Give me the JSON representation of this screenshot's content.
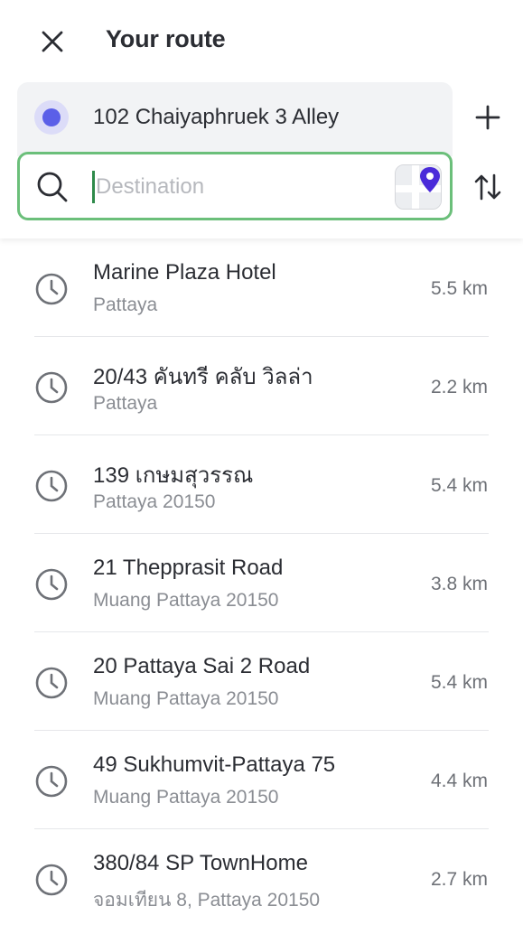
{
  "header": {
    "title": "Your route",
    "close_icon": "close-icon",
    "add_icon": "plus-icon",
    "swap_icon": "swap-vertical-icon"
  },
  "route": {
    "origin": "102 Chaiyaphruek 3 Alley",
    "destination_value": "",
    "destination_placeholder": "Destination",
    "map_picker_icon": "map-pin-icon"
  },
  "colors": {
    "accent": "#5b5fe8",
    "focus_border": "#6bbf7a"
  },
  "recents": [
    {
      "name": "Marine Plaza Hotel",
      "sub": "Pattaya",
      "dist": "5.5 km"
    },
    {
      "name": "20/43 คันทรี คลับ วิลล่า",
      "sub": "Pattaya",
      "dist": "2.2 km"
    },
    {
      "name": "139 เกษมสุวรรณ",
      "sub": "Pattaya 20150",
      "dist": "5.4 km"
    },
    {
      "name": "21 Thepprasit Road",
      "sub": "Muang Pattaya 20150",
      "dist": "3.8 km"
    },
    {
      "name": "20 Pattaya Sai 2 Road",
      "sub": "Muang Pattaya 20150",
      "dist": "5.4 km"
    },
    {
      "name": "49 Sukhumvit-Pattaya 75",
      "sub": "Muang Pattaya 20150",
      "dist": "4.4 km"
    },
    {
      "name": "380/84 SP TownHome",
      "sub": "จอมเทียน 8, Pattaya 20150",
      "dist": "2.7 km"
    }
  ]
}
